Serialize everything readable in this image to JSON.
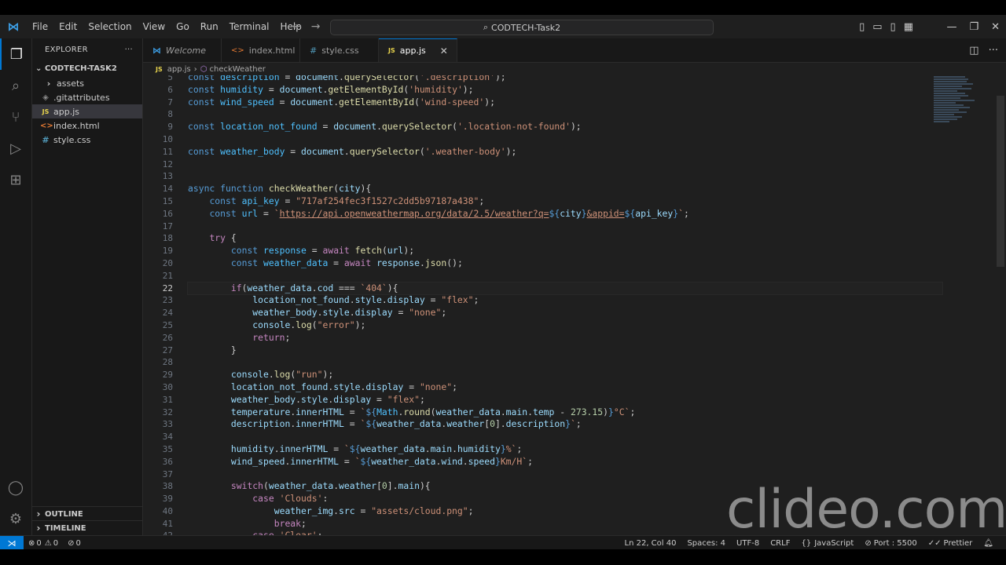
{
  "title_bar": {
    "menu": [
      "File",
      "Edit",
      "Selection",
      "View",
      "Go",
      "Run",
      "Terminal",
      "Help"
    ],
    "command_center": "CODTECH-Task2"
  },
  "sidebar": {
    "header": "EXPLORER",
    "root": "CODTECH-TASK2",
    "files": [
      {
        "name": "assets",
        "icon": "chevron-right-icon"
      },
      {
        "name": ".gitattributes",
        "icon": "git-icon"
      },
      {
        "name": "app.js",
        "icon": "js-icon"
      },
      {
        "name": "index.html",
        "icon": "html-icon"
      },
      {
        "name": "style.css",
        "icon": "css-icon"
      }
    ],
    "outline": "OUTLINE",
    "timeline": "TIMELINE"
  },
  "tabs": [
    {
      "label": "Welcome",
      "icon": "vscode-icon"
    },
    {
      "label": "index.html",
      "icon": "html-icon"
    },
    {
      "label": "style.css",
      "icon": "css-icon"
    },
    {
      "label": "app.js",
      "icon": "js-icon"
    }
  ],
  "breadcrumb": {
    "file": "app.js",
    "symbol": "checkWeather"
  },
  "editor": {
    "line_numbers": [
      "5",
      "6",
      "7",
      "8",
      "9",
      "10",
      "11",
      "12",
      "13",
      "14",
      "15",
      "16",
      "17",
      "18",
      "19",
      "20",
      "21",
      "22",
      "23",
      "24",
      "25",
      "26",
      "27",
      "28",
      "29",
      "30",
      "31",
      "32",
      "33",
      "34",
      "35",
      "36",
      "37",
      "38",
      "39",
      "40",
      "41",
      "42"
    ],
    "current_line": "22"
  },
  "watermark": "clideo.com",
  "status_bar": {
    "errors": "0",
    "warnings": "0",
    "ports": "0",
    "position": "Ln 22, Col 40",
    "spaces": "Spaces: 4",
    "encoding": "UTF-8",
    "eol": "CRLF",
    "language": "JavaScript",
    "port": "Port : 5500",
    "formatter": "Prettier"
  },
  "colors": {
    "accent": "#0078d4",
    "editor_bg": "#1f1f1f",
    "sidebar_bg": "#181818"
  }
}
